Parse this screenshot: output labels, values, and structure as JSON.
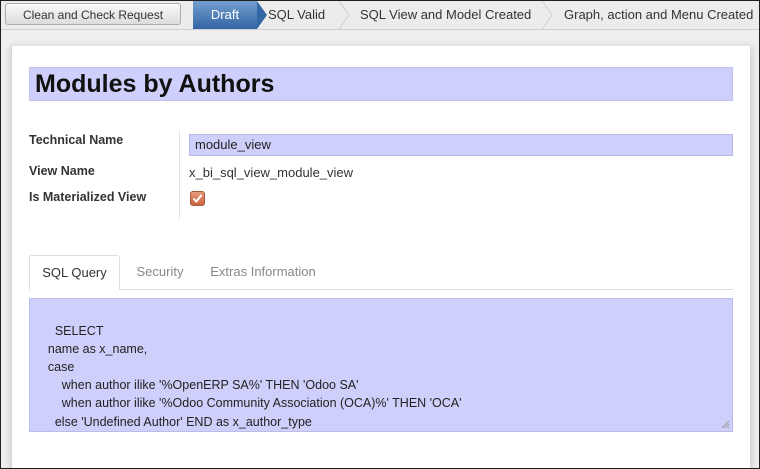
{
  "header": {
    "action_button": "Clean and Check Request",
    "stages": [
      "Draft",
      "SQL Valid",
      "SQL View and Model Created",
      "Graph, action and Menu Created"
    ],
    "active_stage": "Draft",
    "active_color": "#3465a4"
  },
  "form": {
    "title": "Modules by Authors",
    "fields": {
      "technical_name_label": "Technical Name",
      "technical_name_value": "module_view",
      "view_name_label": "View Name",
      "view_name_value": "x_bi_sql_view_module_view",
      "materialized_label": "Is Materialized View",
      "materialized_checked": true
    },
    "editable_field_color": "#cfcffb",
    "checkbox_color": "#c9643f"
  },
  "notebook": {
    "tabs": [
      "SQL Query",
      "Security",
      "Extras Information"
    ],
    "active_tab": "SQL Query",
    "sql_query": "SELECT\n    name as x_name,\n    case\n        when author ilike '%OpenERP SA%' THEN 'Odoo SA'\n        when author ilike '%Odoo Community Association (OCA)%' THEN 'OCA'\n      else 'Undefined Author' END as x_author_type\nFROM ir_module_module"
  },
  "icons": {
    "checkbox_mark": "checkmark-icon",
    "resize_handle": "resize-grip-icon"
  }
}
